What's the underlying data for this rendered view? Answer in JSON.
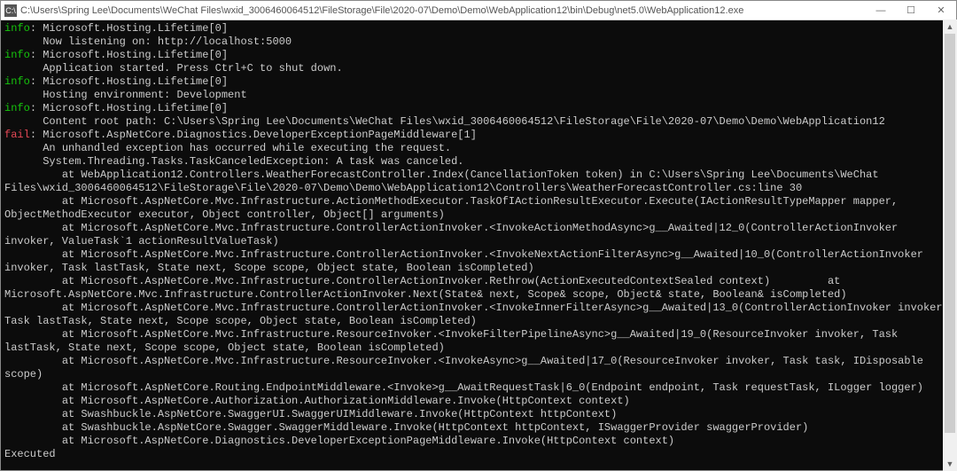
{
  "window": {
    "icon": "C:\\",
    "title": "C:\\Users\\Spring Lee\\Documents\\WeChat Files\\wxid_3006460064512\\FileStorage\\File\\2020-07\\Demo\\Demo\\WebApplication12\\bin\\Debug\\net5.0\\WebApplication12.exe"
  },
  "controls": {
    "minimize": "—",
    "maximize": "☐",
    "close": "✕"
  },
  "log": {
    "lines": [
      {
        "prefix": "info",
        "text": ": Microsoft.Hosting.Lifetime[0]"
      },
      {
        "prefix": "",
        "text": "      Now listening on: http://localhost:5000"
      },
      {
        "prefix": "info",
        "text": ": Microsoft.Hosting.Lifetime[0]"
      },
      {
        "prefix": "",
        "text": "      Application started. Press Ctrl+C to shut down."
      },
      {
        "prefix": "info",
        "text": ": Microsoft.Hosting.Lifetime[0]"
      },
      {
        "prefix": "",
        "text": "      Hosting environment: Development"
      },
      {
        "prefix": "info",
        "text": ": Microsoft.Hosting.Lifetime[0]"
      },
      {
        "prefix": "",
        "text": "      Content root path: C:\\Users\\Spring Lee\\Documents\\WeChat Files\\wxid_3006460064512\\FileStorage\\File\\2020-07\\Demo\\Demo\\WebApplication12"
      },
      {
        "prefix": "fail",
        "text": ": Microsoft.AspNetCore.Diagnostics.DeveloperExceptionPageMiddleware[1]"
      },
      {
        "prefix": "",
        "text": "      An unhandled exception has occurred while executing the request."
      },
      {
        "prefix": "",
        "text": "      System.Threading.Tasks.TaskCanceledException: A task was canceled."
      },
      {
        "prefix": "",
        "text": "         at WebApplication12.Controllers.WeatherForecastController.Index(CancellationToken token) in C:\\Users\\Spring Lee\\Documents\\WeChat Files\\wxid_3006460064512\\FileStorage\\File\\2020-07\\Demo\\Demo\\WebApplication12\\Controllers\\WeatherForecastController.cs:line 30"
      },
      {
        "prefix": "",
        "text": "         at Microsoft.AspNetCore.Mvc.Infrastructure.ActionMethodExecutor.TaskOfIActionResultExecutor.Execute(IActionResultTypeMapper mapper, ObjectMethodExecutor executor, Object controller, Object[] arguments)"
      },
      {
        "prefix": "",
        "text": "         at Microsoft.AspNetCore.Mvc.Infrastructure.ControllerActionInvoker.<InvokeActionMethodAsync>g__Awaited|12_0(ControllerActionInvoker invoker, ValueTask`1 actionResultValueTask)"
      },
      {
        "prefix": "",
        "text": "         at Microsoft.AspNetCore.Mvc.Infrastructure.ControllerActionInvoker.<InvokeNextActionFilterAsync>g__Awaited|10_0(ControllerActionInvoker invoker, Task lastTask, State next, Scope scope, Object state, Boolean isCompleted)"
      },
      {
        "prefix": "",
        "text": "         at Microsoft.AspNetCore.Mvc.Infrastructure.ControllerActionInvoker.Rethrow(ActionExecutedContextSealed context)         at Microsoft.AspNetCore.Mvc.Infrastructure.ControllerActionInvoker.Next(State& next, Scope& scope, Object& state, Boolean& isCompleted)"
      },
      {
        "prefix": "",
        "text": "         at Microsoft.AspNetCore.Mvc.Infrastructure.ControllerActionInvoker.<InvokeInnerFilterAsync>g__Awaited|13_0(ControllerActionInvoker invoker, Task lastTask, State next, Scope scope, Object state, Boolean isCompleted)"
      },
      {
        "prefix": "",
        "text": "         at Microsoft.AspNetCore.Mvc.Infrastructure.ResourceInvoker.<InvokeFilterPipelineAsync>g__Awaited|19_0(ResourceInvoker invoker, Task lastTask, State next, Scope scope, Object state, Boolean isCompleted)"
      },
      {
        "prefix": "",
        "text": "         at Microsoft.AspNetCore.Mvc.Infrastructure.ResourceInvoker.<InvokeAsync>g__Awaited|17_0(ResourceInvoker invoker, Task task, IDisposable scope)"
      },
      {
        "prefix": "",
        "text": "         at Microsoft.AspNetCore.Routing.EndpointMiddleware.<Invoke>g__AwaitRequestTask|6_0(Endpoint endpoint, Task requestTask, ILogger logger)"
      },
      {
        "prefix": "",
        "text": "         at Microsoft.AspNetCore.Authorization.AuthorizationMiddleware.Invoke(HttpContext context)"
      },
      {
        "prefix": "",
        "text": "         at Swashbuckle.AspNetCore.SwaggerUI.SwaggerUIMiddleware.Invoke(HttpContext httpContext)"
      },
      {
        "prefix": "",
        "text": "         at Swashbuckle.AspNetCore.Swagger.SwaggerMiddleware.Invoke(HttpContext httpContext, ISwaggerProvider swaggerProvider)"
      },
      {
        "prefix": "",
        "text": "         at Microsoft.AspNetCore.Diagnostics.DeveloperExceptionPageMiddleware.Invoke(HttpContext context)"
      },
      {
        "prefix": "",
        "text": "Executed"
      }
    ]
  }
}
